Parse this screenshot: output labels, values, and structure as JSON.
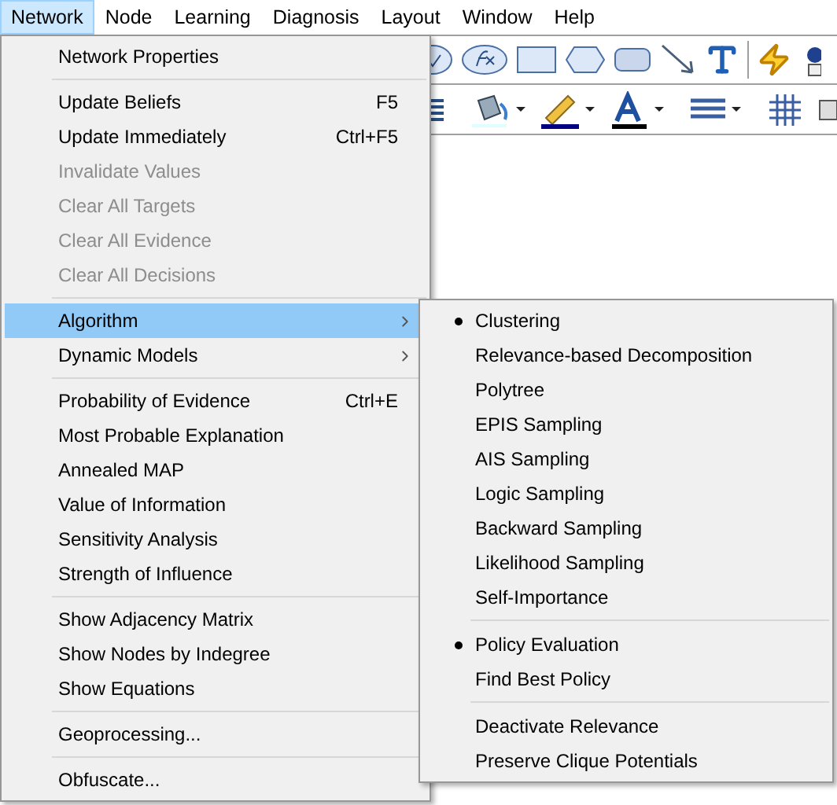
{
  "menubar": [
    {
      "label": "Network",
      "selected": true
    },
    {
      "label": "Node",
      "selected": false
    },
    {
      "label": "Learning",
      "selected": false
    },
    {
      "label": "Diagnosis",
      "selected": false
    },
    {
      "label": "Layout",
      "selected": false
    },
    {
      "label": "Window",
      "selected": false
    },
    {
      "label": "Help",
      "selected": false
    }
  ],
  "network_menu": [
    {
      "kind": "item",
      "label": "Network Properties",
      "disabled": false,
      "selected": false
    },
    {
      "kind": "separator"
    },
    {
      "kind": "item",
      "label": "Update Beliefs",
      "shortcut": "F5",
      "disabled": false,
      "selected": false
    },
    {
      "kind": "item",
      "label": "Update Immediately",
      "shortcut": "Ctrl+F5",
      "disabled": false,
      "selected": false
    },
    {
      "kind": "item",
      "label": "Invalidate Values",
      "disabled": true,
      "selected": false
    },
    {
      "kind": "item",
      "label": "Clear All Targets",
      "disabled": true,
      "selected": false
    },
    {
      "kind": "item",
      "label": "Clear All Evidence",
      "disabled": true,
      "selected": false
    },
    {
      "kind": "item",
      "label": "Clear All Decisions",
      "disabled": true,
      "selected": false
    },
    {
      "kind": "separator"
    },
    {
      "kind": "submenu",
      "label": "Algorithm",
      "disabled": false,
      "selected": true
    },
    {
      "kind": "submenu",
      "label": "Dynamic Models",
      "disabled": false,
      "selected": false
    },
    {
      "kind": "separator"
    },
    {
      "kind": "item",
      "label": "Probability of Evidence",
      "shortcut": "Ctrl+E",
      "disabled": false,
      "selected": false
    },
    {
      "kind": "item",
      "label": "Most Probable Explanation",
      "disabled": false,
      "selected": false
    },
    {
      "kind": "item",
      "label": "Annealed MAP",
      "disabled": false,
      "selected": false
    },
    {
      "kind": "item",
      "label": "Value of Information",
      "disabled": false,
      "selected": false
    },
    {
      "kind": "item",
      "label": "Sensitivity Analysis",
      "disabled": false,
      "selected": false
    },
    {
      "kind": "item",
      "label": "Strength of Influence",
      "disabled": false,
      "selected": false
    },
    {
      "kind": "separator"
    },
    {
      "kind": "item",
      "label": "Show Adjacency Matrix",
      "disabled": false,
      "selected": false
    },
    {
      "kind": "item",
      "label": "Show Nodes by Indegree",
      "disabled": false,
      "selected": false
    },
    {
      "kind": "item",
      "label": "Show Equations",
      "disabled": false,
      "selected": false
    },
    {
      "kind": "separator"
    },
    {
      "kind": "item",
      "label": "Geoprocessing...",
      "disabled": false,
      "selected": false
    },
    {
      "kind": "separator"
    },
    {
      "kind": "item",
      "label": "Obfuscate...",
      "disabled": false,
      "selected": false
    }
  ],
  "algorithm_submenu": [
    {
      "kind": "item",
      "label": "Clustering",
      "checked": true
    },
    {
      "kind": "item",
      "label": "Relevance-based Decomposition",
      "checked": false
    },
    {
      "kind": "item",
      "label": "Polytree",
      "checked": false
    },
    {
      "kind": "item",
      "label": "EPIS Sampling",
      "checked": false
    },
    {
      "kind": "item",
      "label": "AIS Sampling",
      "checked": false
    },
    {
      "kind": "item",
      "label": "Logic Sampling",
      "checked": false
    },
    {
      "kind": "item",
      "label": "Backward Sampling",
      "checked": false
    },
    {
      "kind": "item",
      "label": "Likelihood Sampling",
      "checked": false
    },
    {
      "kind": "item",
      "label": "Self-Importance",
      "checked": false
    },
    {
      "kind": "separator"
    },
    {
      "kind": "item",
      "label": "Policy Evaluation",
      "checked": true
    },
    {
      "kind": "item",
      "label": "Find Best Policy",
      "checked": false
    },
    {
      "kind": "separator"
    },
    {
      "kind": "item",
      "label": "Deactivate Relevance",
      "checked": false
    },
    {
      "kind": "item",
      "label": "Preserve Clique Potentials",
      "checked": false
    }
  ]
}
